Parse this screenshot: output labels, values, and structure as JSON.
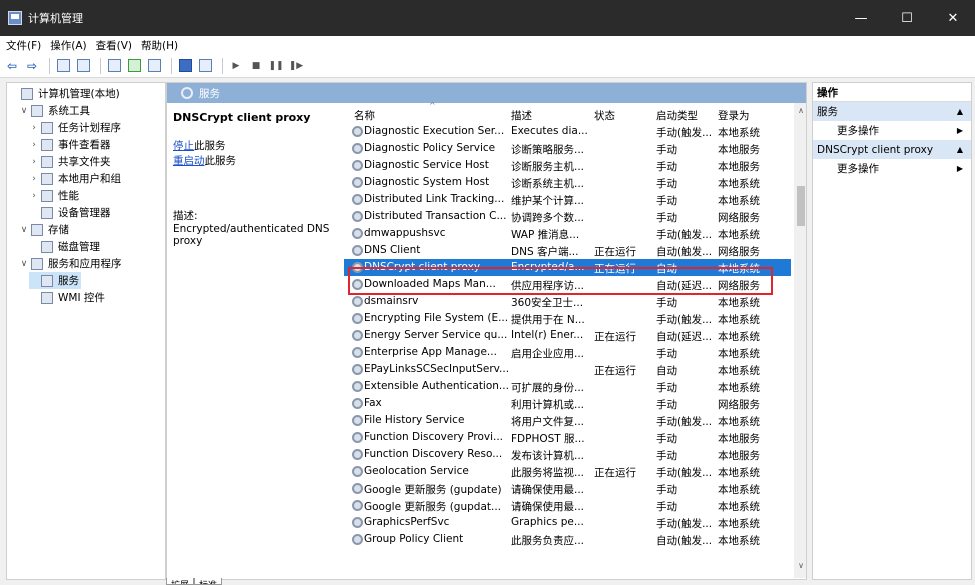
{
  "window": {
    "title": "计算机管理",
    "minimize": "—",
    "maximize": "☐",
    "close": "✕"
  },
  "menu": [
    "文件(F)",
    "操作(A)",
    "查看(V)",
    "帮助(H)"
  ],
  "tree": {
    "items": [
      {
        "label": "计算机管理(本地)",
        "indent": 0,
        "chev": ""
      },
      {
        "label": "系统工具",
        "indent": 1,
        "chev": "∨"
      },
      {
        "label": "任务计划程序",
        "indent": 2,
        "chev": "›"
      },
      {
        "label": "事件查看器",
        "indent": 2,
        "chev": "›"
      },
      {
        "label": "共享文件夹",
        "indent": 2,
        "chev": "›"
      },
      {
        "label": "本地用户和组",
        "indent": 2,
        "chev": "›"
      },
      {
        "label": "性能",
        "indent": 2,
        "chev": "›"
      },
      {
        "label": "设备管理器",
        "indent": 2,
        "chev": ""
      },
      {
        "label": "存储",
        "indent": 1,
        "chev": "∨"
      },
      {
        "label": "磁盘管理",
        "indent": 2,
        "chev": ""
      },
      {
        "label": "服务和应用程序",
        "indent": 1,
        "chev": "∨"
      },
      {
        "label": "服务",
        "indent": 2,
        "chev": "",
        "selected": true
      },
      {
        "label": "WMI 控件",
        "indent": 2,
        "chev": ""
      }
    ]
  },
  "main": {
    "header": "服务",
    "detail": {
      "service_name": "DNSCrypt client proxy",
      "stop_link": "停止",
      "stop_suffix": "此服务",
      "restart_link": "重启动",
      "restart_suffix": "此服务",
      "desc_label": "描述:",
      "desc_text": "Encrypted/authenticated DNS proxy"
    },
    "columns": [
      "名称",
      "描述",
      "状态",
      "启动类型",
      "登录为"
    ],
    "rows": [
      [
        "Diagnostic Execution Ser...",
        "Executes dia...",
        "",
        "手动(触发...",
        "本地系统"
      ],
      [
        "Diagnostic Policy Service",
        "诊断策略服务...",
        "",
        "手动",
        "本地服务"
      ],
      [
        "Diagnostic Service Host",
        "诊断服务主机...",
        "",
        "手动",
        "本地服务"
      ],
      [
        "Diagnostic System Host",
        "诊断系统主机...",
        "",
        "手动",
        "本地系统"
      ],
      [
        "Distributed Link Tracking...",
        "维护某个计算...",
        "",
        "手动",
        "本地系统"
      ],
      [
        "Distributed Transaction C...",
        "协调跨多个数...",
        "",
        "手动",
        "网络服务"
      ],
      [
        "dmwappushsvc",
        "WAP 推消息...",
        "",
        "手动(触发...",
        "本地系统"
      ],
      [
        "DNS Client",
        "DNS 客户端...",
        "正在运行",
        "自动(触发...",
        "网络服务"
      ],
      [
        "DNSCrypt client proxy",
        "Encrypted/a...",
        "正在运行",
        "自动",
        "本地系统"
      ],
      [
        "Downloaded Maps Man...",
        "供应用程序访...",
        "",
        "自动(延迟...",
        "网络服务"
      ],
      [
        "dsmainsrv",
        "360安全卫士...",
        "",
        "手动",
        "本地系统"
      ],
      [
        "Encrypting File System (E...",
        "提供用于在 N...",
        "",
        "手动(触发...",
        "本地系统"
      ],
      [
        "Energy Server Service qu...",
        "Intel(r) Ener...",
        "正在运行",
        "自动(延迟...",
        "本地系统"
      ],
      [
        "Enterprise App Manage...",
        "启用企业应用...",
        "",
        "手动",
        "本地系统"
      ],
      [
        "EPayLinksSCSecInputServ...",
        "",
        "正在运行",
        "自动",
        "本地系统"
      ],
      [
        "Extensible Authentication...",
        "可扩展的身份...",
        "",
        "手动",
        "本地系统"
      ],
      [
        "Fax",
        "利用计算机或...",
        "",
        "手动",
        "网络服务"
      ],
      [
        "File History Service",
        "将用户文件复...",
        "",
        "手动(触发...",
        "本地系统"
      ],
      [
        "Function Discovery Provi...",
        "FDPHOST 服...",
        "",
        "手动",
        "本地服务"
      ],
      [
        "Function Discovery Reso...",
        "发布该计算机...",
        "",
        "手动",
        "本地服务"
      ],
      [
        "Geolocation Service",
        "此服务将监视...",
        "正在运行",
        "手动(触发...",
        "本地系统"
      ],
      [
        "Google 更新服务 (gupdate)",
        "请确保使用最...",
        "",
        "手动",
        "本地系统"
      ],
      [
        "Google 更新服务 (gupdat...",
        "请确保使用最...",
        "",
        "手动",
        "本地系统"
      ],
      [
        "GraphicsPerfSvc",
        "Graphics pe...",
        "",
        "手动(触发...",
        "本地系统"
      ],
      [
        "Group Policy Client",
        "此服务负责应...",
        "",
        "自动(触发...",
        "本地系统"
      ]
    ],
    "selected_row": 8,
    "tabs": [
      "扩展",
      "标准"
    ]
  },
  "actions": {
    "header": "操作",
    "sections": [
      {
        "title": "服务",
        "item": "更多操作"
      },
      {
        "title": "DNSCrypt client proxy",
        "item": "更多操作"
      }
    ]
  }
}
